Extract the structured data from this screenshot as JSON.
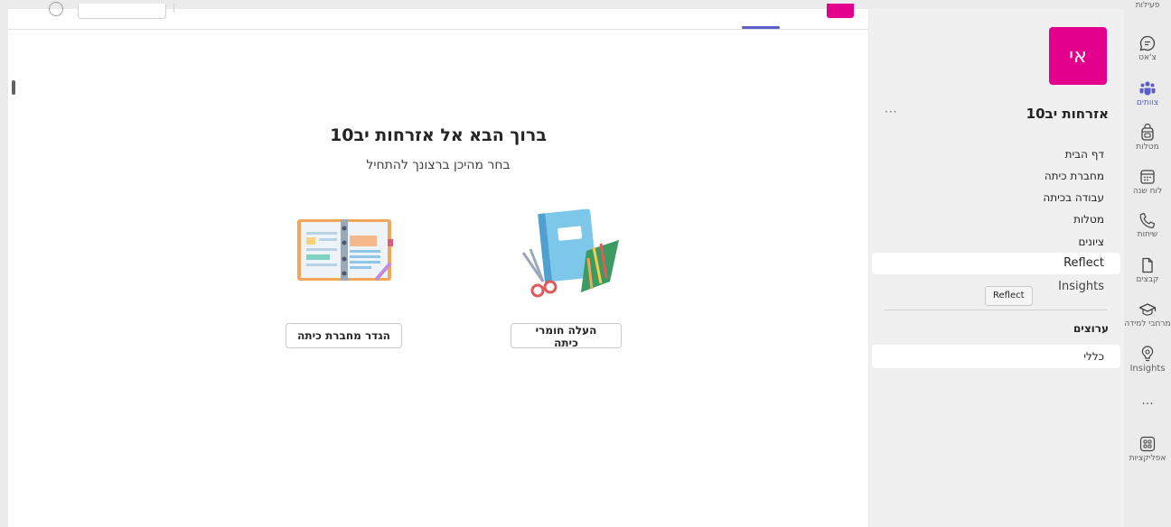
{
  "rail": {
    "items": [
      {
        "label": "פעילות",
        "icon": "bell-icon"
      },
      {
        "label": "צ'אט",
        "icon": "chat-icon"
      },
      {
        "label": "צוותים",
        "icon": "teams-icon",
        "active": true
      },
      {
        "label": "מטלות",
        "icon": "backpack-icon"
      },
      {
        "label": "לוח שנה",
        "icon": "calendar-icon"
      },
      {
        "label": "שיחות",
        "icon": "phone-icon"
      },
      {
        "label": "קבצים",
        "icon": "file-icon"
      },
      {
        "label": "מרחבי למידה",
        "icon": "graduation-cap-icon"
      },
      {
        "label": "Insights",
        "icon": "lightbulb-icon"
      },
      {
        "label": "אפליקציות",
        "icon": "apps-icon"
      }
    ],
    "more": "..."
  },
  "team": {
    "avatar_initials": "אי",
    "avatar_color": "#e3008c",
    "name": "אזרחות יב10",
    "more": "···",
    "nav": [
      {
        "label": "דף הבית"
      },
      {
        "label": "מחברת כיתה"
      },
      {
        "label": "עבודה בכיתה"
      },
      {
        "label": "מטלות"
      },
      {
        "label": "ציונים"
      },
      {
        "label": "Reflect"
      },
      {
        "label": "Insights"
      }
    ],
    "tooltip": "Reflect",
    "channels_title": "ערוצים",
    "channels": [
      {
        "label": "כללי"
      }
    ]
  },
  "main": {
    "accent_color": "#5b5fc7",
    "welcome_title": "ברוך הבא אל אזרחות יב10",
    "welcome_subtitle": "בחר מהיכן ברצונך להתחיל",
    "buttons": {
      "setup_notebook": "הגדר מחברת כיתה",
      "upload_materials": "העלה חומרי כיתה"
    }
  }
}
